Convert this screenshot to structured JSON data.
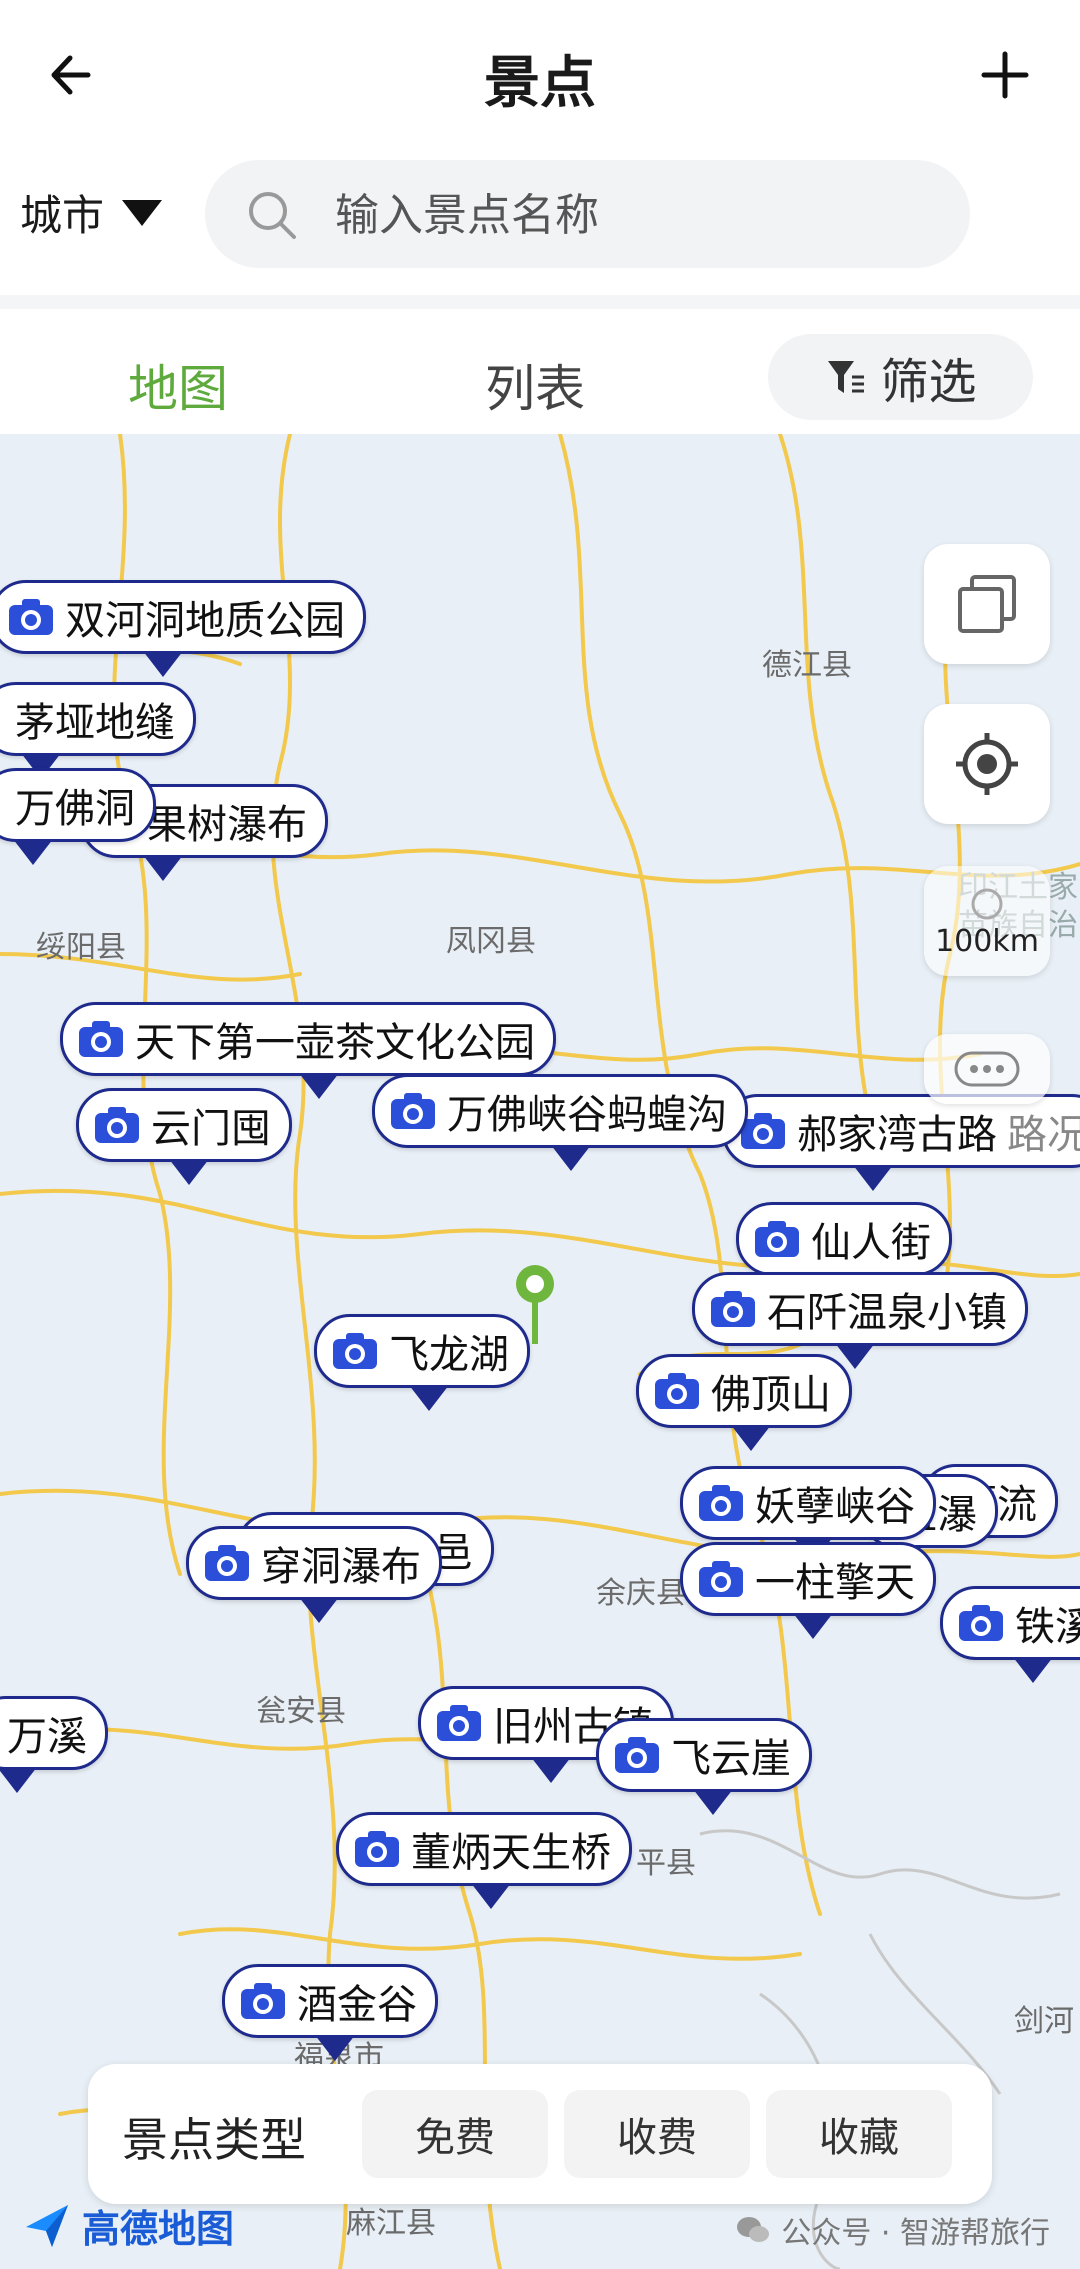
{
  "header": {
    "title": "景点"
  },
  "city_selector": {
    "label": "城市"
  },
  "search": {
    "placeholder": "输入景点名称"
  },
  "tabs": {
    "map": "地图",
    "list": "列表",
    "filter": "筛选",
    "active": "map"
  },
  "colors": {
    "accent_green": "#5faa3c",
    "poi_blue": "#1e2a8c",
    "camera_blue": "#2b4fd8",
    "road_yellow": "#f5c842"
  },
  "map": {
    "places": [
      "德江县",
      "印江土家",
      "苗族自治",
      "绥阳县",
      "凤冈县",
      "余庆县",
      "瓮安县",
      "平县",
      "福泉市",
      "剑河",
      "麻江县"
    ],
    "pois": [
      "双河洞地质公园",
      "茅垭地缝",
      "万佛洞",
      "果树瀑布",
      "天下第一壶茶文化公园",
      "云门囤",
      "万佛峡谷蚂蝗沟",
      "郝家湾古路",
      "仙人街",
      "石阡温泉小镇",
      "飞龙湖",
      "佛顶山",
      "妖孽峡谷",
      "直瀑",
      "漂流",
      "一柱擎天",
      "铁溪",
      "穿洞瀑布",
      "邑",
      "万溪",
      "旧州古镇",
      "飞云崖",
      "董炳天生桥",
      "酒金谷"
    ],
    "scale": "100km",
    "layer_control": "路况"
  },
  "bottom_bar": {
    "title": "景点类型",
    "buttons": [
      "免费",
      "收费",
      "收藏"
    ]
  },
  "footer": {
    "map_brand": "高德地图",
    "watermark": "公众号 · 智游帮旅行"
  }
}
